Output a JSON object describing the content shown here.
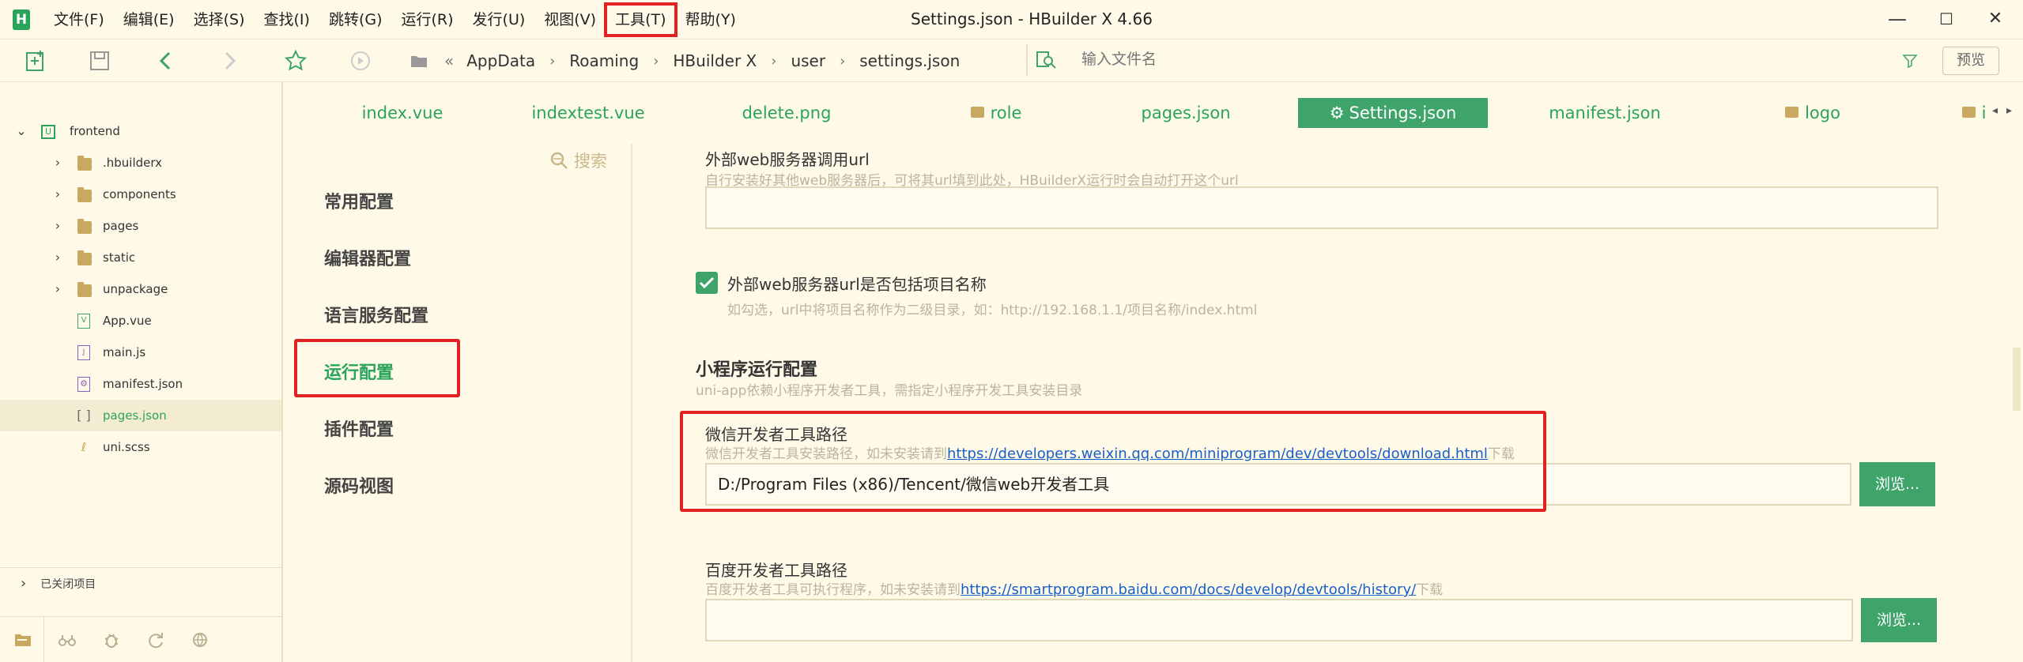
{
  "window": {
    "title": "Settings.json - HBuilder X 4.66",
    "logo": "H"
  },
  "menu": [
    {
      "label": "文件(F)"
    },
    {
      "label": "编辑(E)"
    },
    {
      "label": "选择(S)"
    },
    {
      "label": "查找(I)"
    },
    {
      "label": "跳转(G)"
    },
    {
      "label": "运行(R)"
    },
    {
      "label": "发行(U)"
    },
    {
      "label": "视图(V)"
    },
    {
      "label": "工具(T)",
      "highlighted": true
    },
    {
      "label": "帮助(Y)"
    }
  ],
  "window_controls": {
    "minimize": "—",
    "maximize": "☐",
    "close": "✕"
  },
  "toolbar": {
    "breadcrumb": [
      "AppData",
      "Roaming",
      "HBuilder X",
      "user",
      "settings.json"
    ],
    "search_placeholder": "输入文件名",
    "preview_label": "预览"
  },
  "sidebar": {
    "project": "frontend",
    "items": [
      {
        "label": ".hbuilderx",
        "kind": "folder"
      },
      {
        "label": "components",
        "kind": "folder"
      },
      {
        "label": "pages",
        "kind": "folder"
      },
      {
        "label": "static",
        "kind": "folder"
      },
      {
        "label": "unpackage",
        "kind": "folder"
      },
      {
        "label": "App.vue",
        "kind": "vue"
      },
      {
        "label": "main.js",
        "kind": "js"
      },
      {
        "label": "manifest.json",
        "kind": "gear"
      },
      {
        "label": "pages.json",
        "kind": "json",
        "selected": true
      },
      {
        "label": "uni.scss",
        "kind": "scss"
      }
    ],
    "closed_projects": "已关闭项目"
  },
  "tabs": [
    {
      "label": "index.vue"
    },
    {
      "label": "indextest.vue"
    },
    {
      "label": "delete.png"
    },
    {
      "label": "role",
      "folder": true
    },
    {
      "label": "pages.json"
    },
    {
      "label": "Settings.json",
      "active": true
    },
    {
      "label": "manifest.json"
    },
    {
      "label": "logo",
      "folder": true
    },
    {
      "label": "i",
      "folder": true
    }
  ],
  "settings_nav": {
    "search_label": "搜索",
    "items": [
      {
        "label": "常用配置"
      },
      {
        "label": "编辑器配置"
      },
      {
        "label": "语言服务配置"
      },
      {
        "label": "运行配置",
        "active": true
      },
      {
        "label": "插件配置"
      },
      {
        "label": "源码视图"
      }
    ]
  },
  "content": {
    "ext_url": {
      "label": "外部web服务器调用url",
      "desc": "自行安装好其他web服务器后，可将其url填到此处，HBuilderX运行时会自动打开这个url",
      "value": ""
    },
    "ext_include": {
      "label": "外部web服务器url是否包括项目名称",
      "desc": "如勾选，url中将项目名称作为二级目录，如：http://192.168.1.1/项目名称/index.html",
      "checked": true
    },
    "mini_section": {
      "title": "小程序运行配置",
      "desc": "uni-app依赖小程序开发者工具，需指定小程序开发工具安装目录"
    },
    "wechat": {
      "label": "微信开发者工具路径",
      "desc_prefix": "微信开发者工具安装路径，如未安装请到",
      "link": "https://developers.weixin.qq.com/miniprogram/dev/devtools/download.html",
      "desc_suffix": "下载",
      "value": "D:/Program Files (x86)/Tencent/微信web开发者工具",
      "button": "浏览..."
    },
    "baidu": {
      "label": "百度开发者工具路径",
      "desc_prefix": "百度开发者工具可执行程序，如未安装请到",
      "link": "https://smartprogram.baidu.com/docs/develop/devtools/history/",
      "desc_suffix": "下载",
      "value": "",
      "button": "浏览..."
    }
  },
  "colors": {
    "background": "#fffae8",
    "accent": "#3fa46a",
    "highlight": "#e02222",
    "link": "#1a5fc8"
  }
}
